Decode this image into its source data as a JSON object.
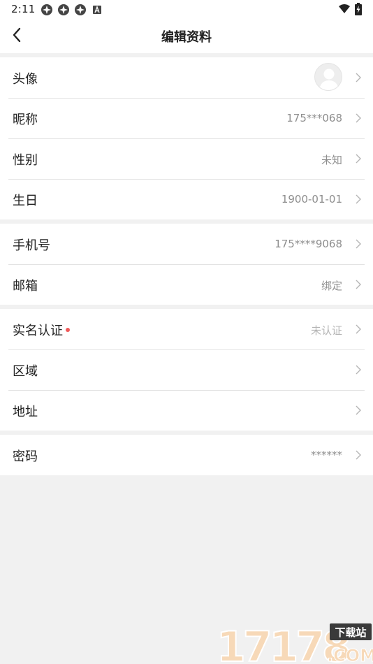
{
  "status_bar": {
    "time": "2:11",
    "left_icons": [
      "app-notification-icon",
      "app-notification-icon",
      "app-notification-icon",
      "keyboard-a-icon"
    ],
    "right_icons": [
      "wifi-icon",
      "battery-charging-icon"
    ]
  },
  "header": {
    "title": "编辑资料",
    "back_icon": "back-arrow-icon"
  },
  "groups": [
    {
      "rows": [
        {
          "label": "头像",
          "value": "",
          "type": "avatar"
        },
        {
          "label": "昵称",
          "value": "175***068"
        },
        {
          "label": "性别",
          "value": "未知"
        },
        {
          "label": "生日",
          "value": "1900-01-01"
        }
      ]
    },
    {
      "rows": [
        {
          "label": "手机号",
          "value": "175****9068"
        },
        {
          "label": "邮箱",
          "value": "绑定"
        }
      ]
    },
    {
      "rows": [
        {
          "label": "实名认证",
          "value": "未认证",
          "has_red_dot": true
        },
        {
          "label": "区域",
          "value": ""
        },
        {
          "label": "地址",
          "value": ""
        }
      ]
    },
    {
      "rows": [
        {
          "label": "密码",
          "value": "******"
        }
      ]
    }
  ],
  "watermark": {
    "text": "17178",
    "suffix": ".COM",
    "tag": "下载站"
  },
  "colors": {
    "background": "#f1f1f1",
    "surface": "#ffffff",
    "value_text": "#8e8e8e",
    "red_dot": "#f05a5a"
  }
}
